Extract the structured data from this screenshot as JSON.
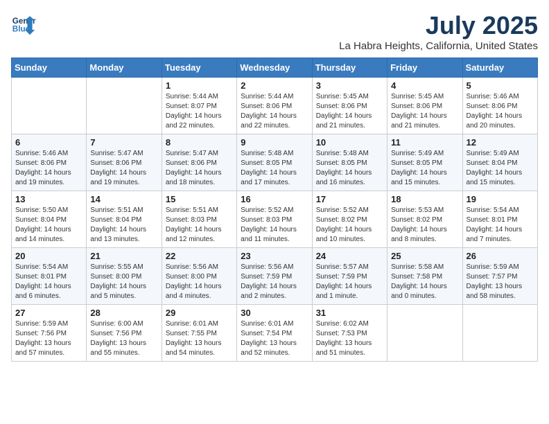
{
  "header": {
    "logo_line1": "General",
    "logo_line2": "Blue",
    "month": "July 2025",
    "location": "La Habra Heights, California, United States"
  },
  "weekdays": [
    "Sunday",
    "Monday",
    "Tuesday",
    "Wednesday",
    "Thursday",
    "Friday",
    "Saturday"
  ],
  "weeks": [
    [
      {
        "day": "",
        "content": ""
      },
      {
        "day": "",
        "content": ""
      },
      {
        "day": "1",
        "content": "Sunrise: 5:44 AM\nSunset: 8:07 PM\nDaylight: 14 hours\nand 22 minutes."
      },
      {
        "day": "2",
        "content": "Sunrise: 5:44 AM\nSunset: 8:06 PM\nDaylight: 14 hours\nand 22 minutes."
      },
      {
        "day": "3",
        "content": "Sunrise: 5:45 AM\nSunset: 8:06 PM\nDaylight: 14 hours\nand 21 minutes."
      },
      {
        "day": "4",
        "content": "Sunrise: 5:45 AM\nSunset: 8:06 PM\nDaylight: 14 hours\nand 21 minutes."
      },
      {
        "day": "5",
        "content": "Sunrise: 5:46 AM\nSunset: 8:06 PM\nDaylight: 14 hours\nand 20 minutes."
      }
    ],
    [
      {
        "day": "6",
        "content": "Sunrise: 5:46 AM\nSunset: 8:06 PM\nDaylight: 14 hours\nand 19 minutes."
      },
      {
        "day": "7",
        "content": "Sunrise: 5:47 AM\nSunset: 8:06 PM\nDaylight: 14 hours\nand 19 minutes."
      },
      {
        "day": "8",
        "content": "Sunrise: 5:47 AM\nSunset: 8:06 PM\nDaylight: 14 hours\nand 18 minutes."
      },
      {
        "day": "9",
        "content": "Sunrise: 5:48 AM\nSunset: 8:05 PM\nDaylight: 14 hours\nand 17 minutes."
      },
      {
        "day": "10",
        "content": "Sunrise: 5:48 AM\nSunset: 8:05 PM\nDaylight: 14 hours\nand 16 minutes."
      },
      {
        "day": "11",
        "content": "Sunrise: 5:49 AM\nSunset: 8:05 PM\nDaylight: 14 hours\nand 15 minutes."
      },
      {
        "day": "12",
        "content": "Sunrise: 5:49 AM\nSunset: 8:04 PM\nDaylight: 14 hours\nand 15 minutes."
      }
    ],
    [
      {
        "day": "13",
        "content": "Sunrise: 5:50 AM\nSunset: 8:04 PM\nDaylight: 14 hours\nand 14 minutes."
      },
      {
        "day": "14",
        "content": "Sunrise: 5:51 AM\nSunset: 8:04 PM\nDaylight: 14 hours\nand 13 minutes."
      },
      {
        "day": "15",
        "content": "Sunrise: 5:51 AM\nSunset: 8:03 PM\nDaylight: 14 hours\nand 12 minutes."
      },
      {
        "day": "16",
        "content": "Sunrise: 5:52 AM\nSunset: 8:03 PM\nDaylight: 14 hours\nand 11 minutes."
      },
      {
        "day": "17",
        "content": "Sunrise: 5:52 AM\nSunset: 8:02 PM\nDaylight: 14 hours\nand 10 minutes."
      },
      {
        "day": "18",
        "content": "Sunrise: 5:53 AM\nSunset: 8:02 PM\nDaylight: 14 hours\nand 8 minutes."
      },
      {
        "day": "19",
        "content": "Sunrise: 5:54 AM\nSunset: 8:01 PM\nDaylight: 14 hours\nand 7 minutes."
      }
    ],
    [
      {
        "day": "20",
        "content": "Sunrise: 5:54 AM\nSunset: 8:01 PM\nDaylight: 14 hours\nand 6 minutes."
      },
      {
        "day": "21",
        "content": "Sunrise: 5:55 AM\nSunset: 8:00 PM\nDaylight: 14 hours\nand 5 minutes."
      },
      {
        "day": "22",
        "content": "Sunrise: 5:56 AM\nSunset: 8:00 PM\nDaylight: 14 hours\nand 4 minutes."
      },
      {
        "day": "23",
        "content": "Sunrise: 5:56 AM\nSunset: 7:59 PM\nDaylight: 14 hours\nand 2 minutes."
      },
      {
        "day": "24",
        "content": "Sunrise: 5:57 AM\nSunset: 7:59 PM\nDaylight: 14 hours\nand 1 minute."
      },
      {
        "day": "25",
        "content": "Sunrise: 5:58 AM\nSunset: 7:58 PM\nDaylight: 14 hours\nand 0 minutes."
      },
      {
        "day": "26",
        "content": "Sunrise: 5:59 AM\nSunset: 7:57 PM\nDaylight: 13 hours\nand 58 minutes."
      }
    ],
    [
      {
        "day": "27",
        "content": "Sunrise: 5:59 AM\nSunset: 7:56 PM\nDaylight: 13 hours\nand 57 minutes."
      },
      {
        "day": "28",
        "content": "Sunrise: 6:00 AM\nSunset: 7:56 PM\nDaylight: 13 hours\nand 55 minutes."
      },
      {
        "day": "29",
        "content": "Sunrise: 6:01 AM\nSunset: 7:55 PM\nDaylight: 13 hours\nand 54 minutes."
      },
      {
        "day": "30",
        "content": "Sunrise: 6:01 AM\nSunset: 7:54 PM\nDaylight: 13 hours\nand 52 minutes."
      },
      {
        "day": "31",
        "content": "Sunrise: 6:02 AM\nSunset: 7:53 PM\nDaylight: 13 hours\nand 51 minutes."
      },
      {
        "day": "",
        "content": ""
      },
      {
        "day": "",
        "content": ""
      }
    ]
  ]
}
